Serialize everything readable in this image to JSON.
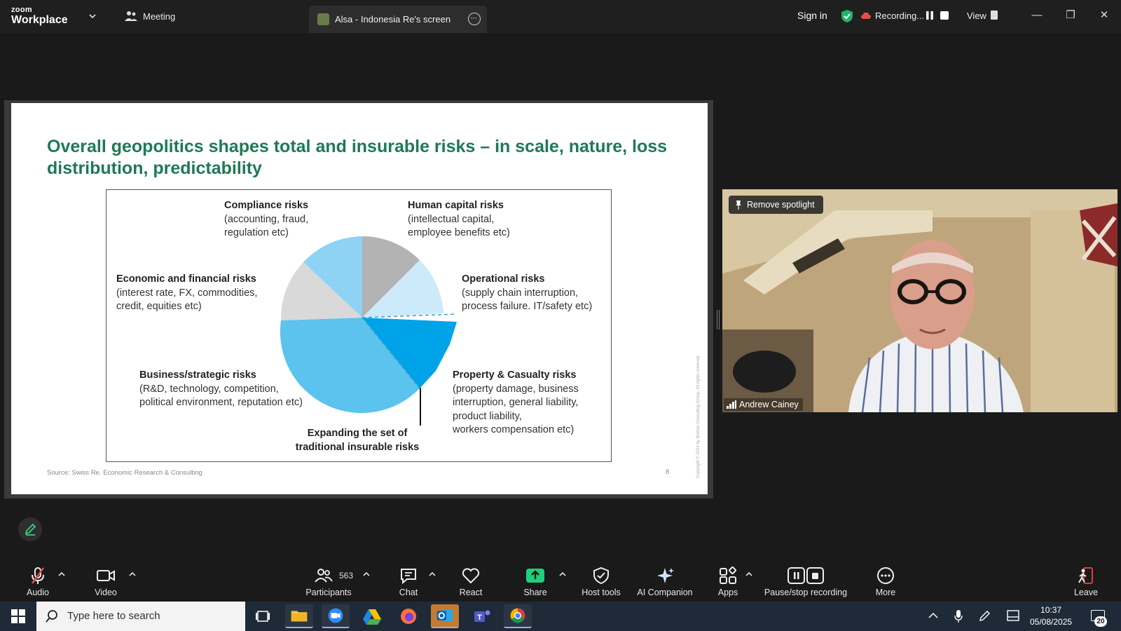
{
  "titlebar": {
    "logo_top": "zoom",
    "logo_bottom": "Workplace",
    "meeting_label": "Meeting",
    "screen_tab_label": "Alsa - Indonesia Re's screen",
    "sign_in": "Sign in",
    "recording_label": "Recording...",
    "view_label": "View"
  },
  "slide": {
    "title": "Overall geopolitics shapes total and insurable risks – in scale, nature, loss distribution, predictability",
    "source": "Source: Swiss Re. Economic Research & Consulting",
    "page_number": "8",
    "copyright": "Copyright © 2024 by Boston Consulting Group. All rights reserved.",
    "labels": {
      "compliance_title": "Compliance risks",
      "compliance_desc1": "(accounting, fraud,",
      "compliance_desc2": "regulation etc)",
      "human_title": "Human capital risks",
      "human_desc1": "(intellectual capital,",
      "human_desc2": "employee benefits etc)",
      "economic_title": "Economic and financial risks",
      "economic_desc1": "(interest rate, FX, commodities,",
      "economic_desc2": "credit, equities etc)",
      "operational_title": "Operational risks",
      "operational_desc1": "(supply chain interruption,",
      "operational_desc2": "process failure. IT/safety etc)",
      "business_title": "Business/strategic risks",
      "business_desc1": "(R&D, technology, competition,",
      "business_desc2": "political environment, reputation etc)",
      "property_title": "Property & Casualty risks",
      "property_desc1": "(property damage, business",
      "property_desc2": "interruption, general liability,",
      "property_desc3": "product liability,",
      "property_desc4": "workers compensation etc)",
      "expanding1": "Expanding the set of",
      "expanding2": "traditional insurable risks"
    }
  },
  "video": {
    "remove_spotlight": "Remove spotlight",
    "participant_name": "Andrew Cainey"
  },
  "toolbar": {
    "audio": "Audio",
    "video": "Video",
    "participants": "Participants",
    "participant_count": "563",
    "chat": "Chat",
    "react": "React",
    "share": "Share",
    "host_tools": "Host tools",
    "ai_companion": "AI Companion",
    "apps": "Apps",
    "pause_stop": "Pause/stop recording",
    "more": "More",
    "leave": "Leave"
  },
  "taskbar": {
    "search_placeholder": "Type here to search",
    "time": "10:37",
    "date": "05/08/2025",
    "notification_count": "20"
  },
  "colors": {
    "slide_title": "#1e7a55",
    "pie_light_blue": "#8fd3f4",
    "pie_blue": "#5cc3ef",
    "pie_strong_blue": "#00a3e8",
    "pie_gray": "#b3b3b3",
    "pie_light_gray": "#d9d9d9",
    "pie_pale_blue": "#cdeafa",
    "share_green": "#1fd17a",
    "leave_red": "#e03b3b"
  }
}
